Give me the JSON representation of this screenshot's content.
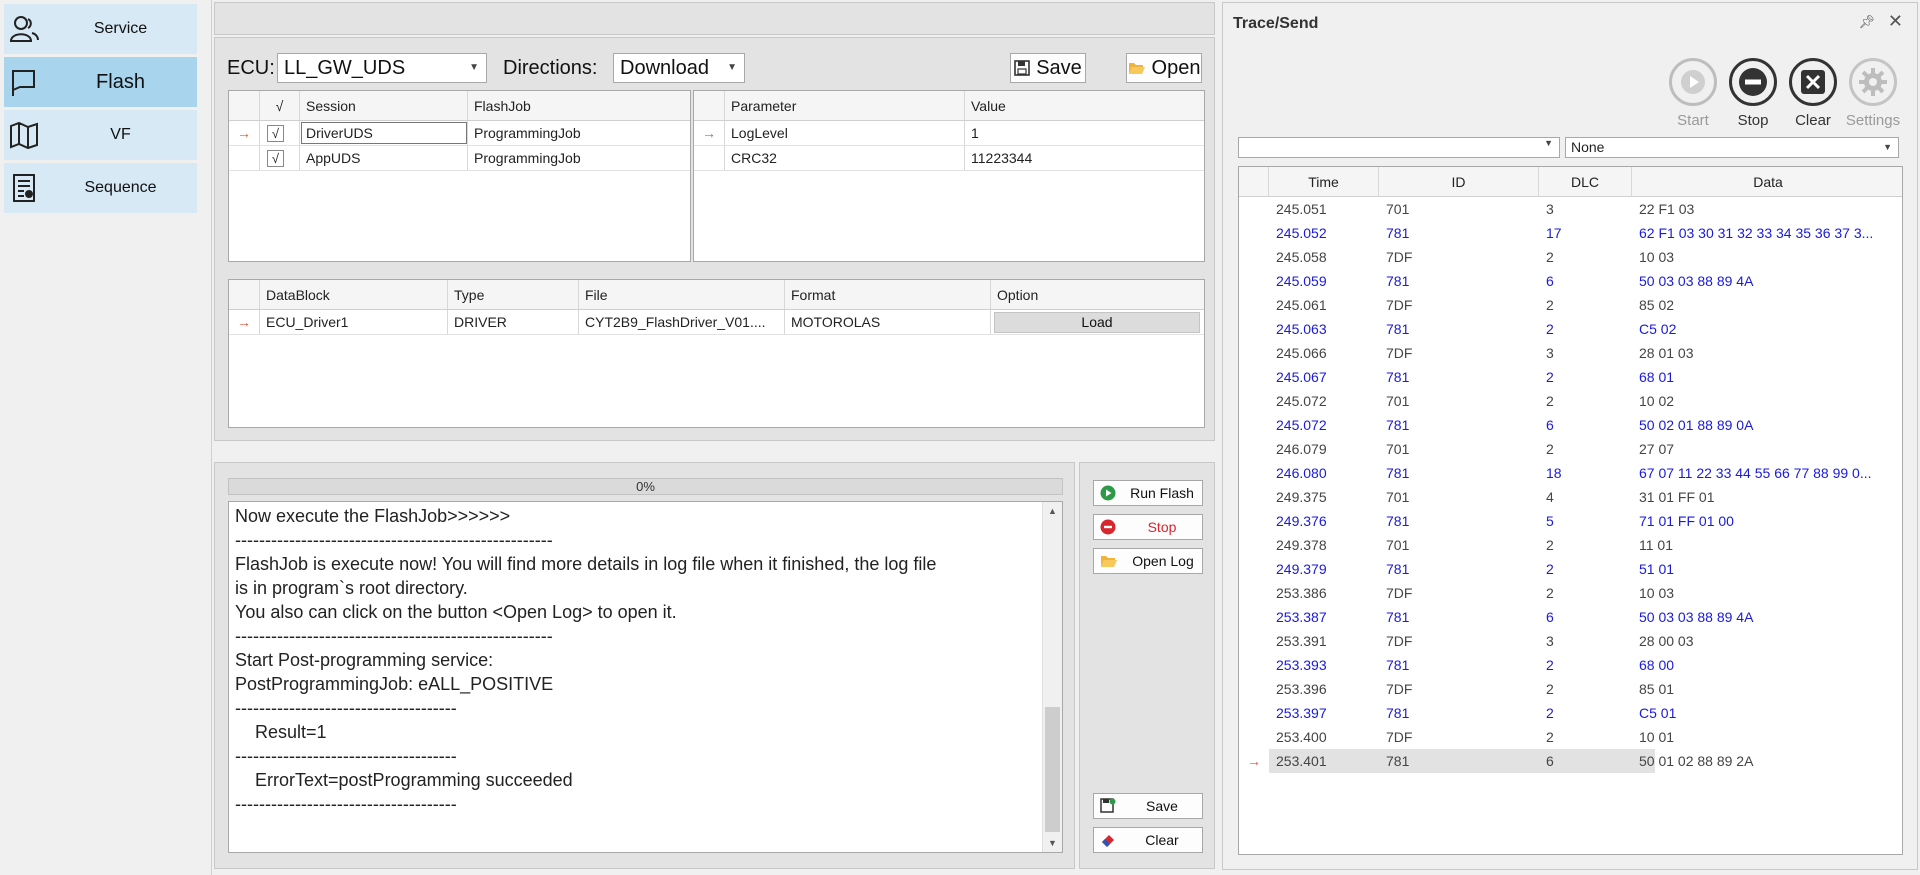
{
  "nav": [
    {
      "label": "Service",
      "icon": "person-icon"
    },
    {
      "label": "Flash",
      "icon": "flag-icon"
    },
    {
      "label": "VF",
      "icon": "map-icon"
    },
    {
      "label": "Sequence",
      "icon": "sequence-document-icon"
    }
  ],
  "flash": {
    "ecu_label": "ECU:",
    "ecu_value": "LL_GW_UDS",
    "directions_label": "Directions:",
    "directions_value": "Download",
    "save_label": "Save",
    "open_label": "Open",
    "session_grid": {
      "check_header": "√",
      "headers": [
        "Session",
        "FlashJob"
      ],
      "rows": [
        {
          "checked": "√",
          "session": "DriverUDS",
          "flashjob": "ProgrammingJob"
        },
        {
          "checked": "√",
          "session": "AppUDS",
          "flashjob": "ProgrammingJob"
        }
      ]
    },
    "param_grid": {
      "headers": [
        "Parameter",
        "Value"
      ],
      "rows": [
        {
          "parameter": "LogLevel",
          "value": "1"
        },
        {
          "parameter": "CRC32",
          "value": "11223344"
        }
      ]
    },
    "datablock_grid": {
      "headers": [
        "DataBlock",
        "Type",
        "File",
        "Format",
        "Option"
      ],
      "rows": [
        {
          "datablock": "ECU_Driver1",
          "type": "DRIVER",
          "file": "CYT2B9_FlashDriver_V01....",
          "format": "MOTOROLAS",
          "option": "Load"
        }
      ]
    },
    "progress": {
      "text": "0%",
      "value": 0
    },
    "log_lines": [
      "Now execute the FlashJob>>>>>>",
      "-----------------------------------------------------",
      "FlashJob is execute now! You will find more details in log file when it finished, the log file",
      "is in program`s root directory.",
      "You also can click on the button <Open Log> to open it.",
      "-----------------------------------------------------",
      "Start Post-programming service:",
      "PostProgrammingJob: eALL_POSITIVE",
      "-------------------------------------",
      "    Result=1",
      "-------------------------------------",
      "    ErrorText=postProgramming succeeded",
      "-------------------------------------"
    ],
    "buttons": {
      "run_flash": "Run Flash",
      "stop": "Stop",
      "open_log": "Open Log",
      "save": "Save",
      "clear": "Clear"
    }
  },
  "trace": {
    "title": "Trace/Send",
    "buttons": [
      "Start",
      "Stop",
      "Clear",
      "Settings"
    ],
    "filter1": "",
    "filter2": "None",
    "headers": [
      "Time",
      "ID",
      "DLC",
      "Data"
    ],
    "rows": [
      {
        "time": "245.051",
        "id": "701",
        "dlc": "3",
        "data": "22 F1 03",
        "color": "black"
      },
      {
        "time": "245.052",
        "id": "781",
        "dlc": "17",
        "data": "62 F1 03 30 31 32 33 34 35 36 37 3...",
        "color": "blue"
      },
      {
        "time": "245.058",
        "id": "7DF",
        "dlc": "2",
        "data": "10 03",
        "color": "black"
      },
      {
        "time": "245.059",
        "id": "781",
        "dlc": "6",
        "data": "50 03 03 88 89 4A",
        "color": "blue"
      },
      {
        "time": "245.061",
        "id": "7DF",
        "dlc": "2",
        "data": "85 02",
        "color": "black"
      },
      {
        "time": "245.063",
        "id": "781",
        "dlc": "2",
        "data": "C5 02",
        "color": "blue"
      },
      {
        "time": "245.066",
        "id": "7DF",
        "dlc": "3",
        "data": "28 01 03",
        "color": "black"
      },
      {
        "time": "245.067",
        "id": "781",
        "dlc": "2",
        "data": "68 01",
        "color": "blue"
      },
      {
        "time": "245.072",
        "id": "701",
        "dlc": "2",
        "data": "10 02",
        "color": "black"
      },
      {
        "time": "245.072",
        "id": "781",
        "dlc": "6",
        "data": "50 02 01 88 89 0A",
        "color": "blue"
      },
      {
        "time": "246.079",
        "id": "701",
        "dlc": "2",
        "data": "27 07",
        "color": "black"
      },
      {
        "time": "246.080",
        "id": "781",
        "dlc": "18",
        "data": "67 07 11 22 33 44 55 66 77 88 99 0...",
        "color": "blue"
      },
      {
        "time": "249.375",
        "id": "701",
        "dlc": "4",
        "data": "31 01 FF 01",
        "color": "black"
      },
      {
        "time": "249.376",
        "id": "781",
        "dlc": "5",
        "data": "71 01 FF 01 00",
        "color": "blue"
      },
      {
        "time": "249.378",
        "id": "701",
        "dlc": "2",
        "data": "11 01",
        "color": "black"
      },
      {
        "time": "249.379",
        "id": "781",
        "dlc": "2",
        "data": "51 01",
        "color": "blue"
      },
      {
        "time": "253.386",
        "id": "7DF",
        "dlc": "2",
        "data": "10 03",
        "color": "black"
      },
      {
        "time": "253.387",
        "id": "781",
        "dlc": "6",
        "data": "50 03 03 88 89 4A",
        "color": "blue"
      },
      {
        "time": "253.391",
        "id": "7DF",
        "dlc": "3",
        "data": "28 00 03",
        "color": "black"
      },
      {
        "time": "253.393",
        "id": "781",
        "dlc": "2",
        "data": "68 00",
        "color": "blue"
      },
      {
        "time": "253.396",
        "id": "7DF",
        "dlc": "2",
        "data": "85 01",
        "color": "black"
      },
      {
        "time": "253.397",
        "id": "781",
        "dlc": "2",
        "data": "C5 01",
        "color": "blue"
      },
      {
        "time": "253.400",
        "id": "7DF",
        "dlc": "2",
        "data": "10 01",
        "color": "black"
      },
      {
        "time": "253.401",
        "id": "781",
        "dlc": "6",
        "data": "50 01 02 88 89 2A",
        "color": "black",
        "selected": true
      }
    ]
  }
}
